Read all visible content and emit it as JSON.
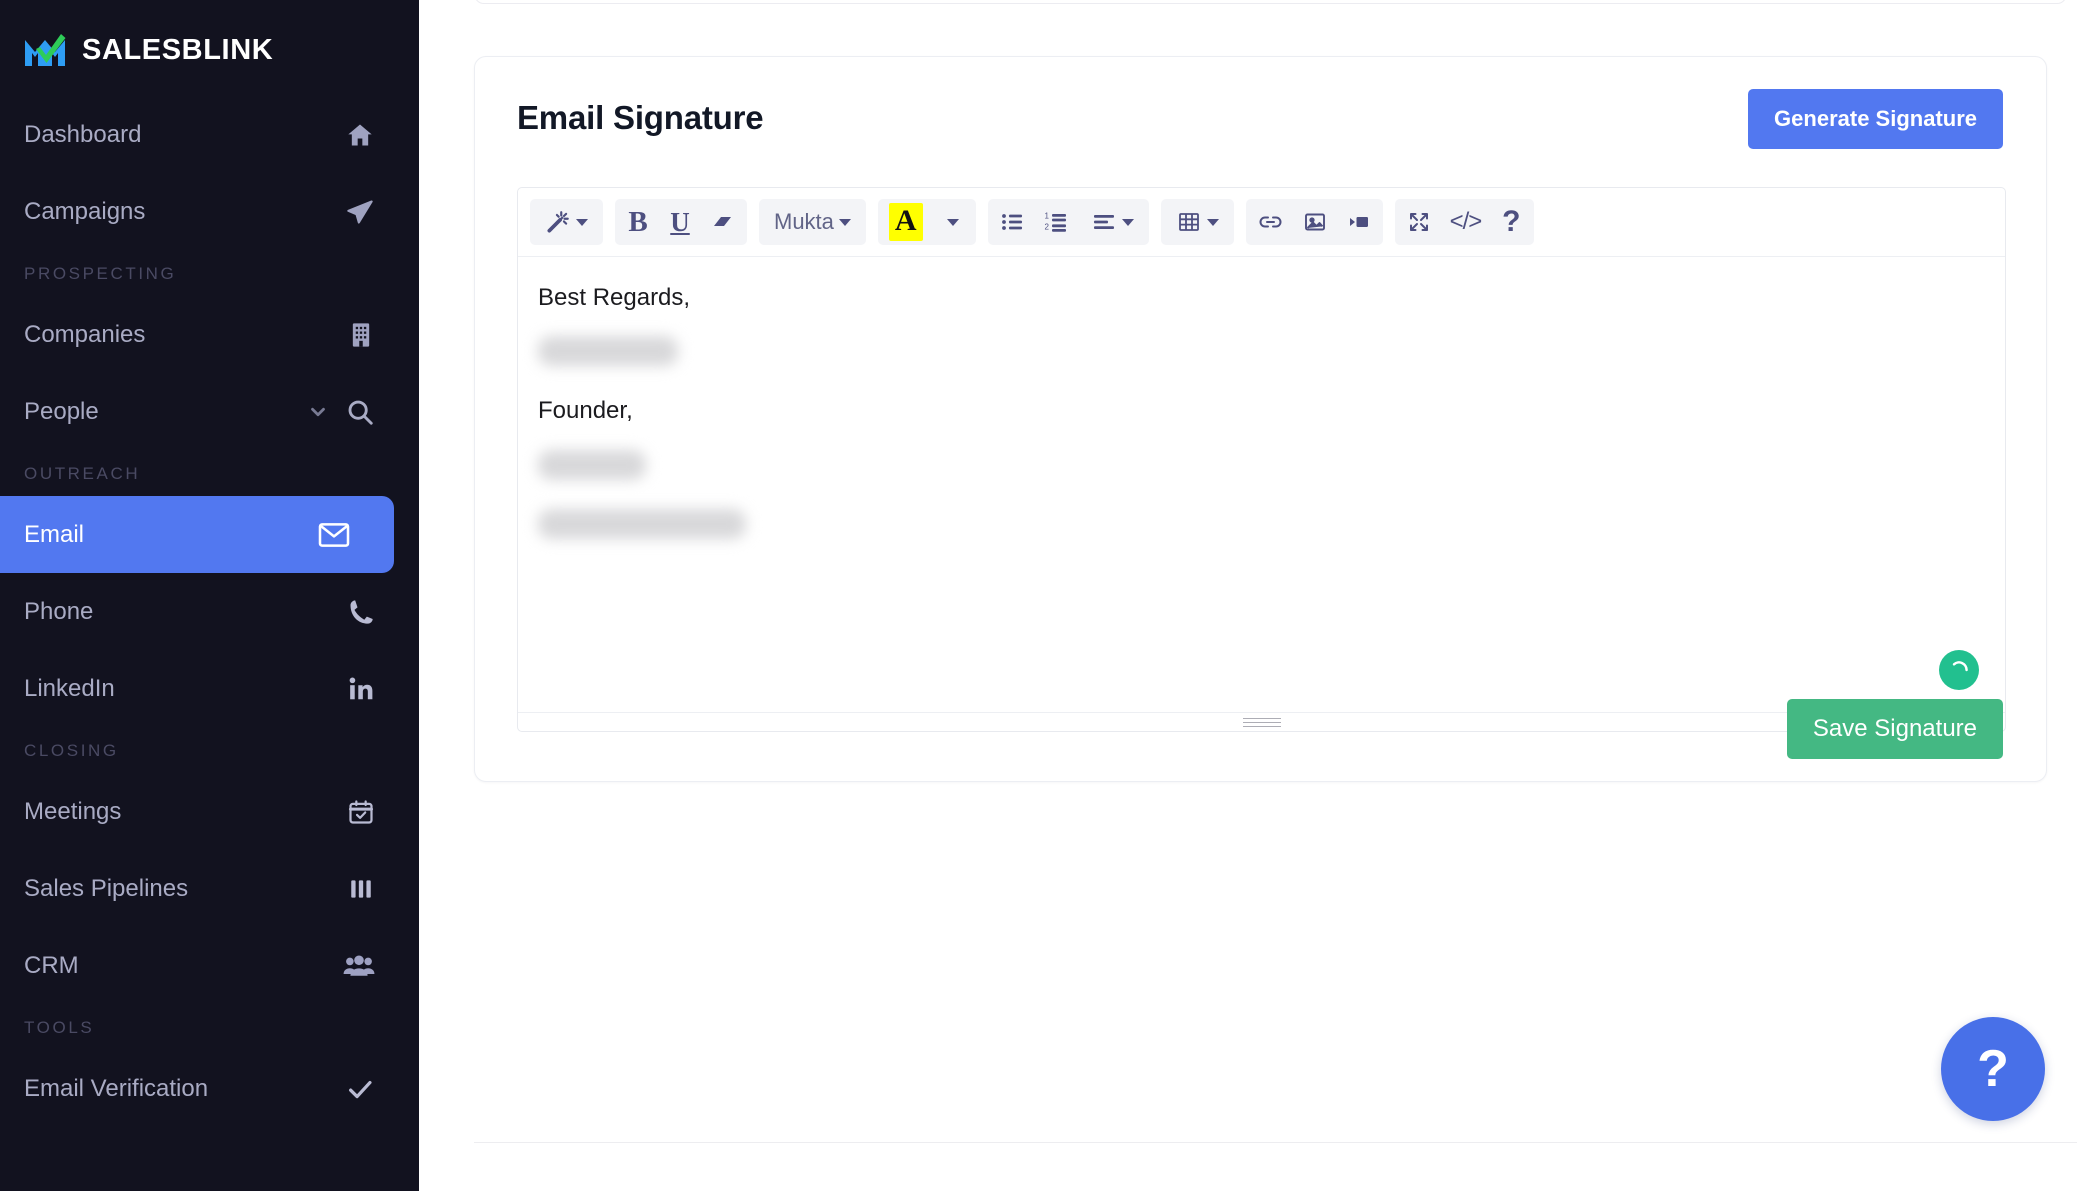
{
  "brand": {
    "name": "SALESBLINK",
    "logo_icon": "salesblink-logo-icon"
  },
  "sidebar": {
    "items": [
      {
        "label": "Dashboard",
        "icon": "home-icon",
        "type": "item",
        "active": false
      },
      {
        "label": "Campaigns",
        "icon": "paper-plane-icon",
        "type": "item",
        "active": false
      },
      {
        "label": "PROSPECTING",
        "type": "section"
      },
      {
        "label": "Companies",
        "icon": "building-icon",
        "type": "item",
        "active": false
      },
      {
        "label": "People",
        "icon": "search-icon",
        "extra_icon": "chevron-down-icon",
        "type": "item",
        "active": false
      },
      {
        "label": "OUTREACH",
        "type": "section"
      },
      {
        "label": "Email",
        "icon": "envelope-icon",
        "type": "item",
        "active": true
      },
      {
        "label": "Phone",
        "icon": "phone-icon",
        "type": "item",
        "active": false
      },
      {
        "label": "LinkedIn",
        "icon": "linkedin-icon",
        "type": "item",
        "active": false
      },
      {
        "label": "CLOSING",
        "type": "section"
      },
      {
        "label": "Meetings",
        "icon": "calendar-check-icon",
        "type": "item",
        "active": false
      },
      {
        "label": "Sales Pipelines",
        "icon": "columns-icon",
        "type": "item",
        "active": false
      },
      {
        "label": "CRM",
        "icon": "users-icon",
        "type": "item",
        "active": false
      },
      {
        "label": "TOOLS",
        "type": "section"
      },
      {
        "label": "Email Verification",
        "icon": "check-icon",
        "type": "item",
        "active": false
      }
    ]
  },
  "card": {
    "title": "Email Signature",
    "generate_button": "Generate Signature",
    "save_button": "Save Signature"
  },
  "toolbar": {
    "groups": [
      {
        "buttons": [
          {
            "name": "magic-wand-icon",
            "glyph": "wand",
            "caret": true
          }
        ]
      },
      {
        "buttons": [
          {
            "name": "bold-button",
            "glyph": "B"
          },
          {
            "name": "underline-button",
            "glyph": "U"
          },
          {
            "name": "remove-format-button",
            "glyph": "eraser"
          }
        ]
      },
      {
        "buttons": [
          {
            "name": "font-family-dropdown",
            "glyph": "font",
            "label": "Mukta",
            "caret": true
          }
        ]
      },
      {
        "buttons": [
          {
            "name": "text-highlight-button",
            "glyph": "A"
          },
          {
            "name": "text-color-dropdown",
            "glyph": "caret-only",
            "caret": true
          }
        ]
      },
      {
        "buttons": [
          {
            "name": "unordered-list-button",
            "glyph": "ul"
          },
          {
            "name": "ordered-list-button",
            "glyph": "ol"
          },
          {
            "name": "paragraph-align-dropdown",
            "glyph": "align",
            "caret": true
          }
        ]
      },
      {
        "buttons": [
          {
            "name": "table-dropdown",
            "glyph": "table",
            "caret": true
          }
        ]
      },
      {
        "buttons": [
          {
            "name": "insert-link-button",
            "glyph": "link"
          },
          {
            "name": "insert-image-button",
            "glyph": "image"
          },
          {
            "name": "insert-video-button",
            "glyph": "video"
          }
        ]
      },
      {
        "buttons": [
          {
            "name": "fullscreen-button",
            "glyph": "expand"
          },
          {
            "name": "code-view-button",
            "glyph": "code"
          },
          {
            "name": "help-button",
            "glyph": "?"
          }
        ]
      }
    ],
    "font_family_value": "Mukta",
    "highlight_color": "#ffff00"
  },
  "signature": {
    "lines": [
      {
        "type": "text",
        "value": "Best Regards,"
      },
      {
        "type": "redacted",
        "width_class": "r1"
      },
      {
        "type": "text",
        "value": "Founder,"
      },
      {
        "type": "redacted",
        "width_class": "r2"
      },
      {
        "type": "redacted",
        "width_class": "r3"
      }
    ],
    "spinner_icon": "loading-spinner-icon",
    "resize_handle": "editor-resize-grip"
  },
  "help_fab": {
    "label": "?",
    "icon": "question-mark-icon"
  },
  "colors": {
    "sidebar_bg": "#12121f",
    "accent_blue": "#5278f0",
    "save_green": "#44b883",
    "spinner_green": "#22c08f",
    "highlight_yellow": "#ffff00"
  }
}
